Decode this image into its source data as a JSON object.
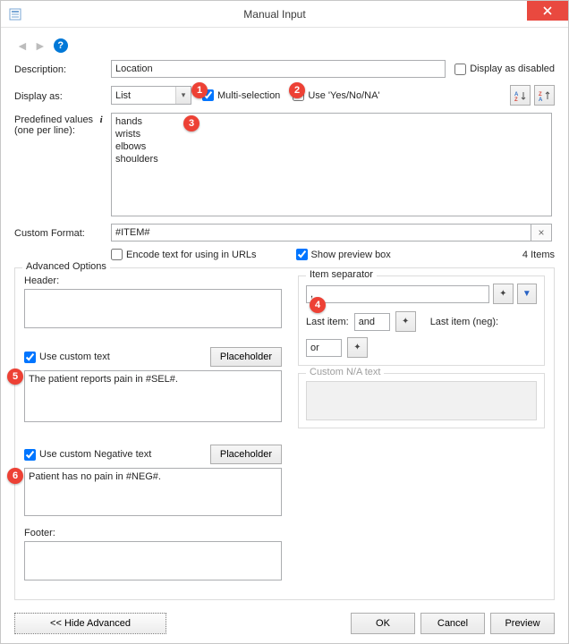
{
  "window": {
    "title": "Manual Input"
  },
  "labels": {
    "description": "Description:",
    "display_as": "Display as:",
    "predefined_line1": "Predefined values",
    "predefined_line2": "(one per line):",
    "custom_format": "Custom Format:",
    "display_disabled": "Display as disabled",
    "multi_selection": "Multi-selection",
    "use_yesnona": "Use 'Yes/No/NA'",
    "encode_urls": "Encode text for using in URLs",
    "show_preview": "Show preview box",
    "items_count": "4 Items",
    "advanced": "Advanced Options",
    "header": "Header:",
    "item_separator": "Item separator",
    "last_item": "Last item:",
    "last_item_neg": "Last item (neg):",
    "use_custom_text": "Use custom text",
    "use_custom_neg": "Use custom Negative text",
    "custom_na": "Custom N/A text",
    "footer": "Footer:",
    "placeholder_btn": "Placeholder"
  },
  "values": {
    "description": "Location",
    "display_as": "List",
    "predefined": "hands\nwrists\nelbows\nshoulders",
    "custom_format": "#ITEM#",
    "header": "",
    "separator": ",",
    "last_item": "and",
    "last_item_neg": "or",
    "custom_text": "The patient reports pain in #SEL#.",
    "custom_neg_text": "Patient has no pain in #NEG#.",
    "footer": ""
  },
  "checks": {
    "display_disabled": false,
    "multi_selection": true,
    "use_yesnona": false,
    "encode_urls": false,
    "show_preview": true,
    "use_custom_text": true,
    "use_custom_neg": true
  },
  "buttons": {
    "hide_advanced": "<< Hide Advanced",
    "ok": "OK",
    "cancel": "Cancel",
    "preview": "Preview"
  },
  "callouts": {
    "c1": "1",
    "c2": "2",
    "c3": "3",
    "c4": "4",
    "c5": "5",
    "c6": "6"
  }
}
